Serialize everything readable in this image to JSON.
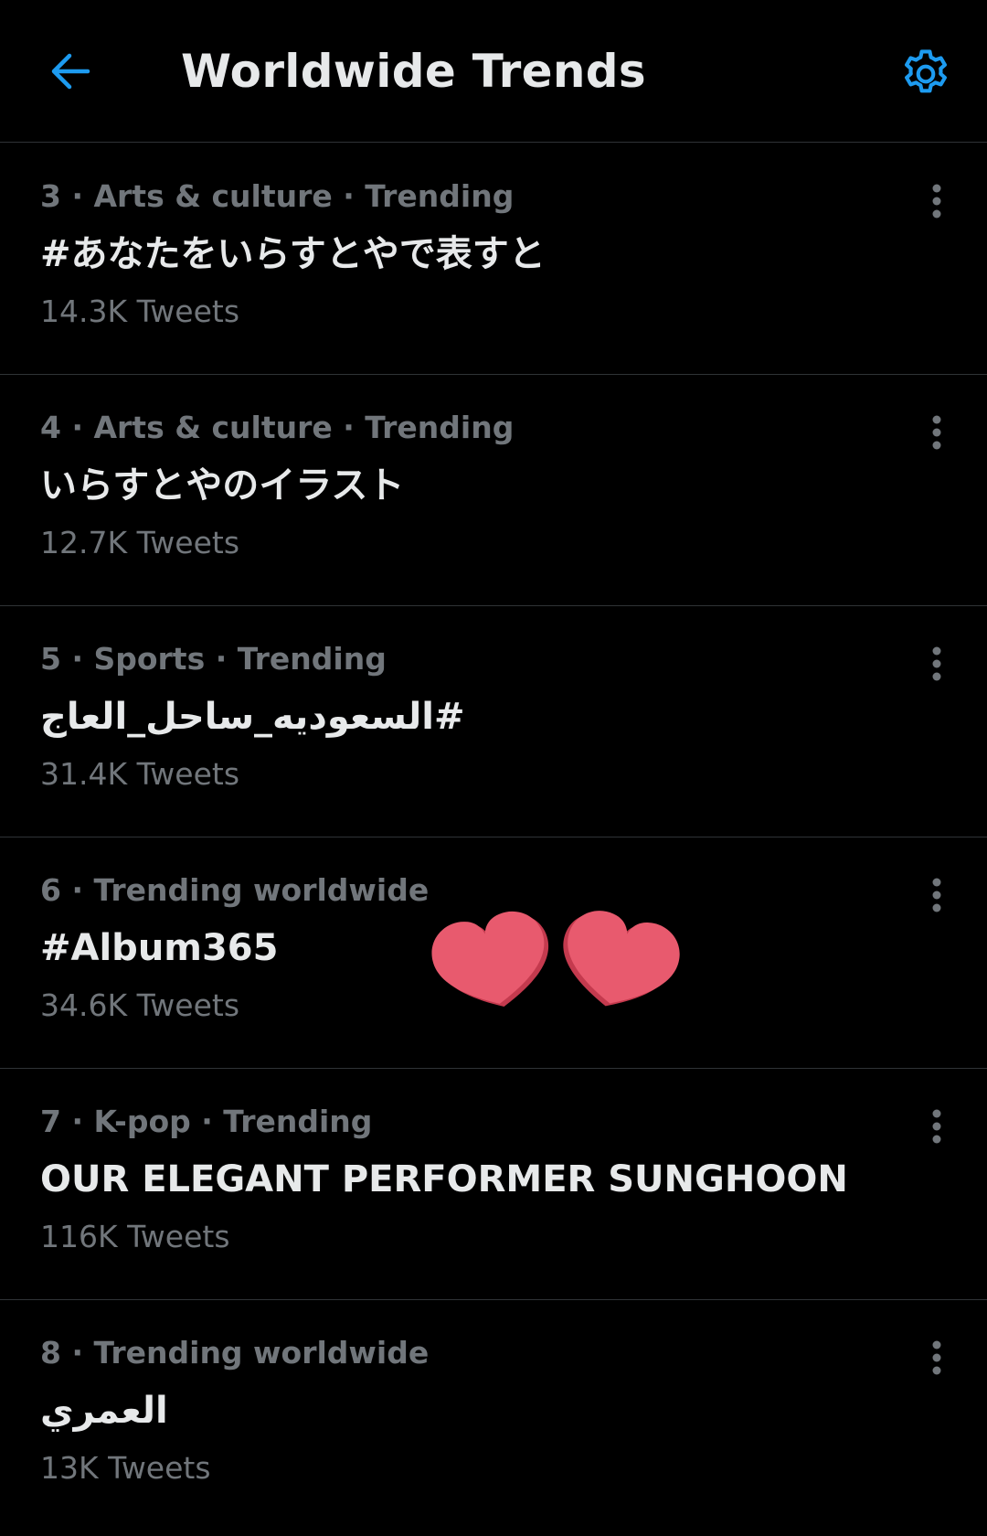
{
  "header": {
    "title": "Worldwide Trends",
    "back_icon": "arrow-left-icon",
    "settings_icon": "gear-icon",
    "accent_color": "#1d9bf0"
  },
  "trends": [
    {
      "meta": "3 · Arts & culture · Trending",
      "name": "#あなたをいらすとやで表すと",
      "count": "14.3K Tweets"
    },
    {
      "meta": "4 · Arts & culture · Trending",
      "name": "いらすとやのイラスト",
      "count": "12.7K Tweets"
    },
    {
      "meta": "5 · Sports · Trending",
      "name": "#السعوديه_ساحل_العاج",
      "count": "31.4K Tweets"
    },
    {
      "meta": "6 · Trending worldwide",
      "name": "#Album365",
      "count": "34.6K Tweets"
    },
    {
      "meta": "7 · K-pop · Trending",
      "name": "OUR ELEGANT PERFORMER SUNGHOON",
      "count": "116K Tweets"
    },
    {
      "meta": "8 · Trending worldwide",
      "name": "العمري",
      "count": "13K Tweets"
    }
  ],
  "overlay": {
    "sticker": "heart-stickers",
    "color": "#e85a6e"
  }
}
